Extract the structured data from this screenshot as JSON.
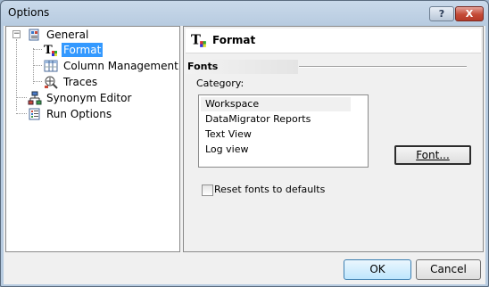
{
  "window": {
    "title": "Options",
    "help_label": "?",
    "close_label": "X"
  },
  "tree": {
    "items": [
      {
        "label": "General",
        "icon": "general-settings-icon",
        "expander": "−"
      },
      {
        "label": "Format",
        "icon": "format-text-icon"
      },
      {
        "label": "Column Management",
        "icon": "column-grid-icon"
      },
      {
        "label": "Traces",
        "icon": "traces-icon"
      },
      {
        "label": "Synonym Editor",
        "icon": "synonym-editor-icon"
      },
      {
        "label": "Run Options",
        "icon": "run-options-icon"
      }
    ],
    "selected": "Format"
  },
  "panel": {
    "header_title": "Format",
    "header_icon": "format-text-icon",
    "fonts_heading": "Fonts",
    "category_label": "Category:",
    "categories": [
      "Workspace",
      "DataMigrator Reports",
      "Text View",
      "Log view"
    ],
    "selected_category": "Workspace",
    "font_button": "Font...",
    "reset_label": "Reset fonts to defaults",
    "reset_checked": false
  },
  "footer": {
    "ok_label": "OK",
    "cancel_label": "Cancel"
  },
  "colors": {
    "selection": "#3399ff",
    "close_button": "#c44a37",
    "title_gradient": "#c9d9ea"
  }
}
